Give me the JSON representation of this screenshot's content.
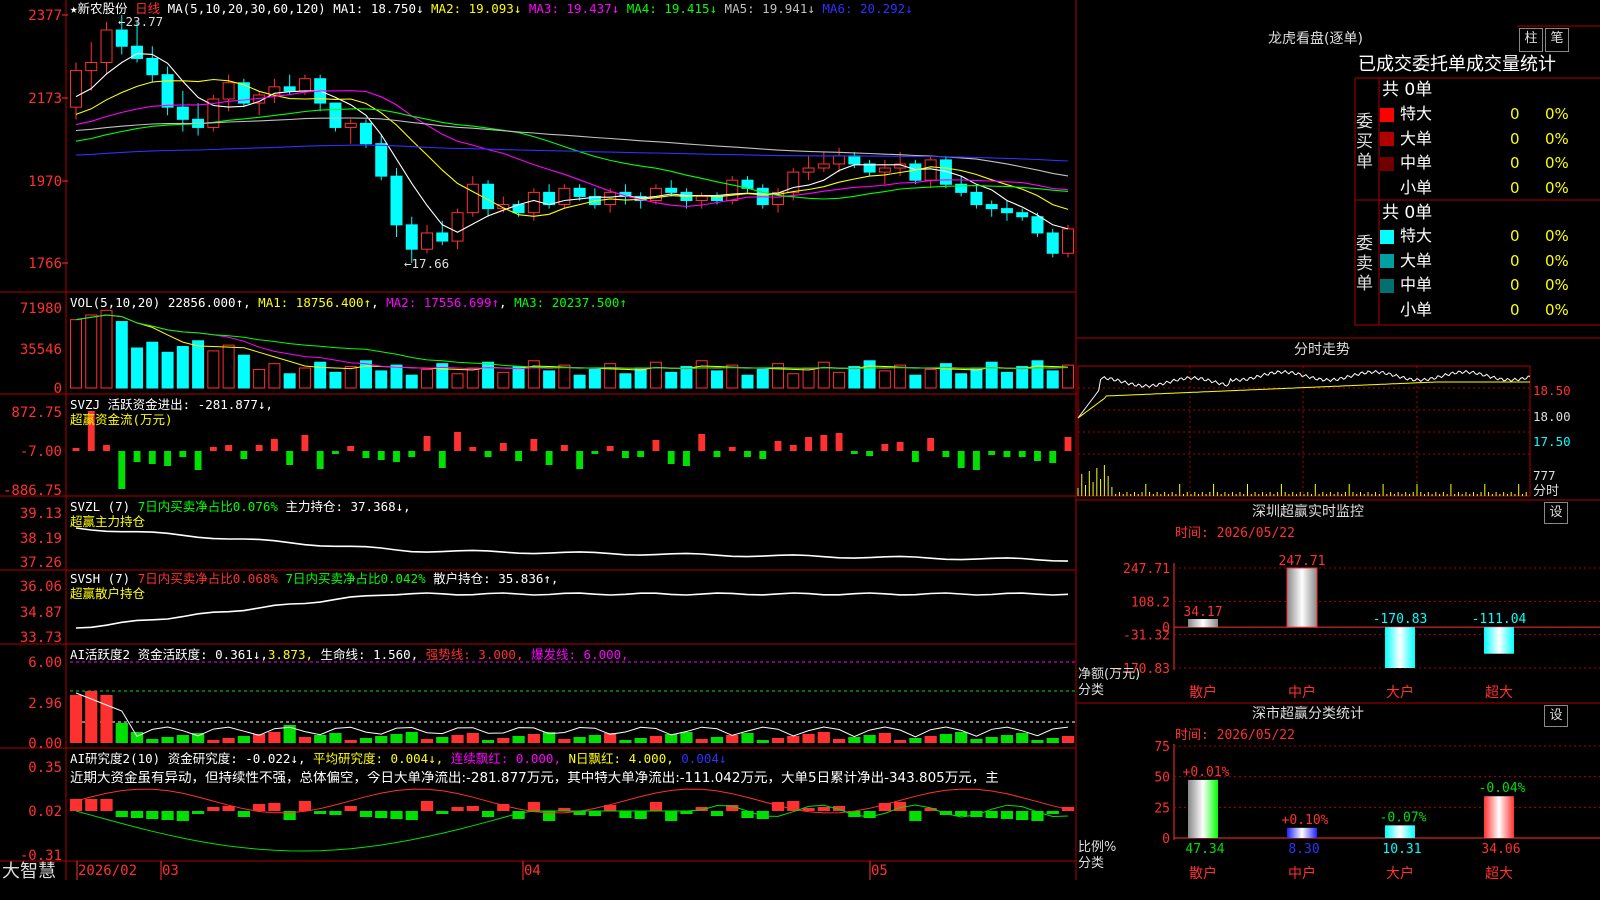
{
  "colors": {
    "up": "#ff3030",
    "down": "#00ffff",
    "grid": "#b00000",
    "ma5": "#ffffff",
    "ma10": "#ffff00",
    "ma20": "#ff00ff",
    "ma30": "#00ff00",
    "ma60": "#c0c0c0",
    "ma120": "#3030ff",
    "yellow": "#ffff00",
    "green": "#00e000"
  },
  "stock": {
    "name": "★新农股份",
    "period": "日线",
    "ma_header": "MA(5,10,20,30,60,120)",
    "ma": [
      {
        "label": "MA1:",
        "value": "18.750↓",
        "color": "#ffffff"
      },
      {
        "label": "MA2:",
        "value": "19.093↓",
        "color": "#ffff00"
      },
      {
        "label": "MA3:",
        "value": "19.437↓",
        "color": "#ff00ff"
      },
      {
        "label": "MA4:",
        "value": "19.415↓",
        "color": "#00ff00"
      },
      {
        "label": "MA5:",
        "value": "19.941↓",
        "color": "#c0c0c0"
      },
      {
        "label": "MA6:",
        "value": "20.292↓",
        "color": "#3030ff"
      }
    ],
    "high_mark": "23.77",
    "low_mark": "17.66"
  },
  "price_axis": [
    "2377",
    "2173",
    "1970",
    "1766"
  ],
  "vol": {
    "header": "VOL(5,10,20)",
    "value": "22856.000↑",
    "ma1": "MA1: 18756.400↑",
    "ma2": "MA2: 17556.699↑",
    "ma3": "MA3: 20237.500↑",
    "axis": [
      "71980",
      "35546",
      "0"
    ]
  },
  "svzj": {
    "line1": "SVZJ  活跃资金进出: -281.877↓,",
    "line2": "超赢资金流(万元)",
    "axis": [
      "872.75",
      "-7.00",
      "-886.75"
    ]
  },
  "svzl": {
    "line1a": "SVZL (7) ",
    "line1b": "7日内买卖净占比0.076%",
    "line1c": " 主力持仓: 37.368↓,",
    "line2": "超赢主力持仓",
    "axis": [
      "39.13",
      "38.19",
      "37.26"
    ]
  },
  "svsh": {
    "line1a": "SVSH (7) ",
    "line1b": "7日内买卖净占比0.068%",
    "line1c": " 7日内买卖净占比0.042%",
    "line1d": " 散户持仓: 35.836↑,",
    "line2": "超赢散户持仓",
    "axis": [
      "36.06",
      "34.87",
      "33.73"
    ]
  },
  "ai1": {
    "a": "AI活跃度2 ",
    "b": "资金活跃度: 0.361↓,",
    "c": "3.873,",
    "d": " 生命线: 1.560,",
    "e": " 强势线: 3.000,",
    "f": " 爆发线: 6.000,",
    "axis": [
      "6.00",
      "2.96",
      "0.00"
    ]
  },
  "ai2": {
    "a": "AI研究度2(10) ",
    "b": "资金研究度: -0.022↓,",
    "c": " 平均研究度: 0.004↓,",
    "d": " 连续飘红: 0.000,",
    "e": " N日飘红: 4.000,",
    "f": " 0.004↓",
    "desc": "近期大资金虽有异动，但持续性不强，总体偏空，今日大单净流出:-281.877万元，其中特大单净流出:-111.042万元，大单5日累计净出-343.805万元，主",
    "axis": [
      "0.35",
      "0.02",
      "-0.31"
    ]
  },
  "date_axis": {
    "brand": "大智慧",
    "labels": [
      "2026/02",
      "03",
      "04",
      "05"
    ]
  },
  "lhb": {
    "title": "龙虎看盘(逐单)",
    "btn1": "柱",
    "btn2": "笔",
    "stat_title": "已成交委托单成交量统计",
    "buy_label": "委买单",
    "sell_label": "委卖单",
    "buy_total": "共 0单",
    "sell_total": "共 0单",
    "buy_rows": [
      {
        "name": "特大",
        "count": "0",
        "pct": "0%",
        "color": "#ff0000"
      },
      {
        "name": "大单",
        "count": "0",
        "pct": "0%",
        "color": "#b00000"
      },
      {
        "name": "中单",
        "count": "0",
        "pct": "0%",
        "color": "#700000"
      },
      {
        "name": "小单",
        "count": "0",
        "pct": "0%",
        "color": "#000000"
      }
    ],
    "sell_rows": [
      {
        "name": "特大",
        "count": "0",
        "pct": "0%",
        "color": "#00ffff"
      },
      {
        "name": "大单",
        "count": "0",
        "pct": "0%",
        "color": "#00a0a0"
      },
      {
        "name": "中单",
        "count": "0",
        "pct": "0%",
        "color": "#007070"
      },
      {
        "name": "小单",
        "count": "0",
        "pct": "0%",
        "color": "#000000"
      }
    ]
  },
  "fenshi": {
    "title": "分时走势",
    "axis": [
      "18.50",
      "18.00",
      "17.50",
      "777"
    ],
    "unit": "分时"
  },
  "sz_monitor": {
    "title": "深圳超赢实时监控",
    "set": "设",
    "time": "时间: 2026/05/22",
    "axis": [
      "247.71",
      "108.2",
      "0",
      "-31.32",
      "-170.83"
    ],
    "ylabel1": "净额(万元)",
    "ylabel2": "分类",
    "chart_data": {
      "type": "bar",
      "categories": [
        "散户",
        "中户",
        "大户",
        "超大"
      ],
      "values": [
        34.17,
        247.71,
        -170.83,
        -111.04
      ],
      "labels": [
        "34.17",
        "247.71",
        "-170.83",
        "-111.04"
      ],
      "ylabel": "净额(万元)",
      "ylim": [
        -170.83,
        247.71
      ]
    }
  },
  "sz_class": {
    "title": "深市超赢分类统计",
    "set": "设",
    "time": "时间: 2026/05/22",
    "axis": [
      "75",
      "50",
      "25",
      "0"
    ],
    "ylabel1": "比例%",
    "ylabel2": "分类",
    "chart_data": {
      "type": "bar",
      "categories": [
        "散户",
        "中户",
        "大户",
        "超大"
      ],
      "values": [
        47.34,
        8.3,
        10.31,
        34.06
      ],
      "changes": [
        "+0.01%",
        "+0.10%",
        "-0.07%",
        "-0.04%"
      ],
      "labels": [
        "47.34",
        "8.30",
        "10.31",
        "34.06"
      ],
      "ylabel": "比例%",
      "ylim": [
        0,
        75
      ]
    }
  },
  "chart_data": {
    "type": "candlestick",
    "title": "新农股份 日线",
    "x_range": [
      "2026/02",
      "2026/05/22"
    ],
    "ylim": [
      17.66,
      23.77
    ],
    "candles_ohlc": [
      [
        21.5,
        22.6,
        21.2,
        22.4
      ],
      [
        22.4,
        23.1,
        21.9,
        22.6
      ],
      [
        22.6,
        23.6,
        22.3,
        23.4
      ],
      [
        23.4,
        23.77,
        22.8,
        23.0
      ],
      [
        23.0,
        23.6,
        22.6,
        22.7
      ],
      [
        22.7,
        23.0,
        22.1,
        22.3
      ],
      [
        22.3,
        22.5,
        21.3,
        21.5
      ],
      [
        21.5,
        21.9,
        20.9,
        21.2
      ],
      [
        21.2,
        21.6,
        20.8,
        21.0
      ],
      [
        21.0,
        21.8,
        20.9,
        21.7
      ],
      [
        21.7,
        22.3,
        21.4,
        22.1
      ],
      [
        22.1,
        22.2,
        21.5,
        21.6
      ],
      [
        21.6,
        21.9,
        21.3,
        21.8
      ],
      [
        21.8,
        22.2,
        21.6,
        22.0
      ],
      [
        22.0,
        22.3,
        21.8,
        21.9
      ],
      [
        21.9,
        22.3,
        21.8,
        22.2
      ],
      [
        22.2,
        22.3,
        21.4,
        21.6
      ],
      [
        21.6,
        21.6,
        20.9,
        21.0
      ],
      [
        21.0,
        21.2,
        20.6,
        21.1
      ],
      [
        21.1,
        21.2,
        20.5,
        20.6
      ],
      [
        20.6,
        20.8,
        19.7,
        19.8
      ],
      [
        19.8,
        20.0,
        18.3,
        18.6
      ],
      [
        18.6,
        18.8,
        17.66,
        18.0
      ],
      [
        18.0,
        18.6,
        17.9,
        18.4
      ],
      [
        18.4,
        18.7,
        18.1,
        18.2
      ],
      [
        18.2,
        19.0,
        18.0,
        18.9
      ],
      [
        18.9,
        19.8,
        18.8,
        19.6
      ],
      [
        19.6,
        19.7,
        18.8,
        19.0
      ],
      [
        19.0,
        19.3,
        18.9,
        19.1
      ],
      [
        19.1,
        19.2,
        18.8,
        18.9
      ],
      [
        18.9,
        19.5,
        18.7,
        19.4
      ],
      [
        19.4,
        19.6,
        19.0,
        19.1
      ],
      [
        19.1,
        19.6,
        19.0,
        19.5
      ],
      [
        19.5,
        19.6,
        19.2,
        19.3
      ],
      [
        19.3,
        19.5,
        19.0,
        19.1
      ],
      [
        19.1,
        19.5,
        18.9,
        19.4
      ],
      [
        19.4,
        19.6,
        19.1,
        19.3
      ],
      [
        19.3,
        19.4,
        19.0,
        19.2
      ],
      [
        19.2,
        19.6,
        19.1,
        19.5
      ],
      [
        19.5,
        19.7,
        19.3,
        19.4
      ],
      [
        19.4,
        19.5,
        19.0,
        19.2
      ],
      [
        19.2,
        19.4,
        19.0,
        19.3
      ],
      [
        19.3,
        19.4,
        19.1,
        19.2
      ],
      [
        19.2,
        19.8,
        19.1,
        19.7
      ],
      [
        19.7,
        19.8,
        19.4,
        19.5
      ],
      [
        19.5,
        19.6,
        19.0,
        19.1
      ],
      [
        19.1,
        19.5,
        18.9,
        19.4
      ],
      [
        19.4,
        20.0,
        19.2,
        19.9
      ],
      [
        19.9,
        20.3,
        19.7,
        20.0
      ],
      [
        20.0,
        20.4,
        19.9,
        20.1
      ],
      [
        20.1,
        20.5,
        19.9,
        20.3
      ],
      [
        20.3,
        20.4,
        20.0,
        20.1
      ],
      [
        20.1,
        20.2,
        19.8,
        19.9
      ],
      [
        19.9,
        20.2,
        19.6,
        20.0
      ],
      [
        20.0,
        20.4,
        19.8,
        20.1
      ],
      [
        20.1,
        20.2,
        19.6,
        19.7
      ],
      [
        19.7,
        20.3,
        19.5,
        20.2
      ],
      [
        20.2,
        20.3,
        19.5,
        19.6
      ],
      [
        19.6,
        19.8,
        19.3,
        19.4
      ],
      [
        19.4,
        19.6,
        19.0,
        19.1
      ],
      [
        19.1,
        19.2,
        18.8,
        19.0
      ],
      [
        19.0,
        19.2,
        18.7,
        18.9
      ],
      [
        18.9,
        19.0,
        18.7,
        18.8
      ],
      [
        18.8,
        18.9,
        18.3,
        18.4
      ],
      [
        18.4,
        18.5,
        17.8,
        17.9
      ],
      [
        17.9,
        18.6,
        17.8,
        18.5
      ]
    ]
  }
}
